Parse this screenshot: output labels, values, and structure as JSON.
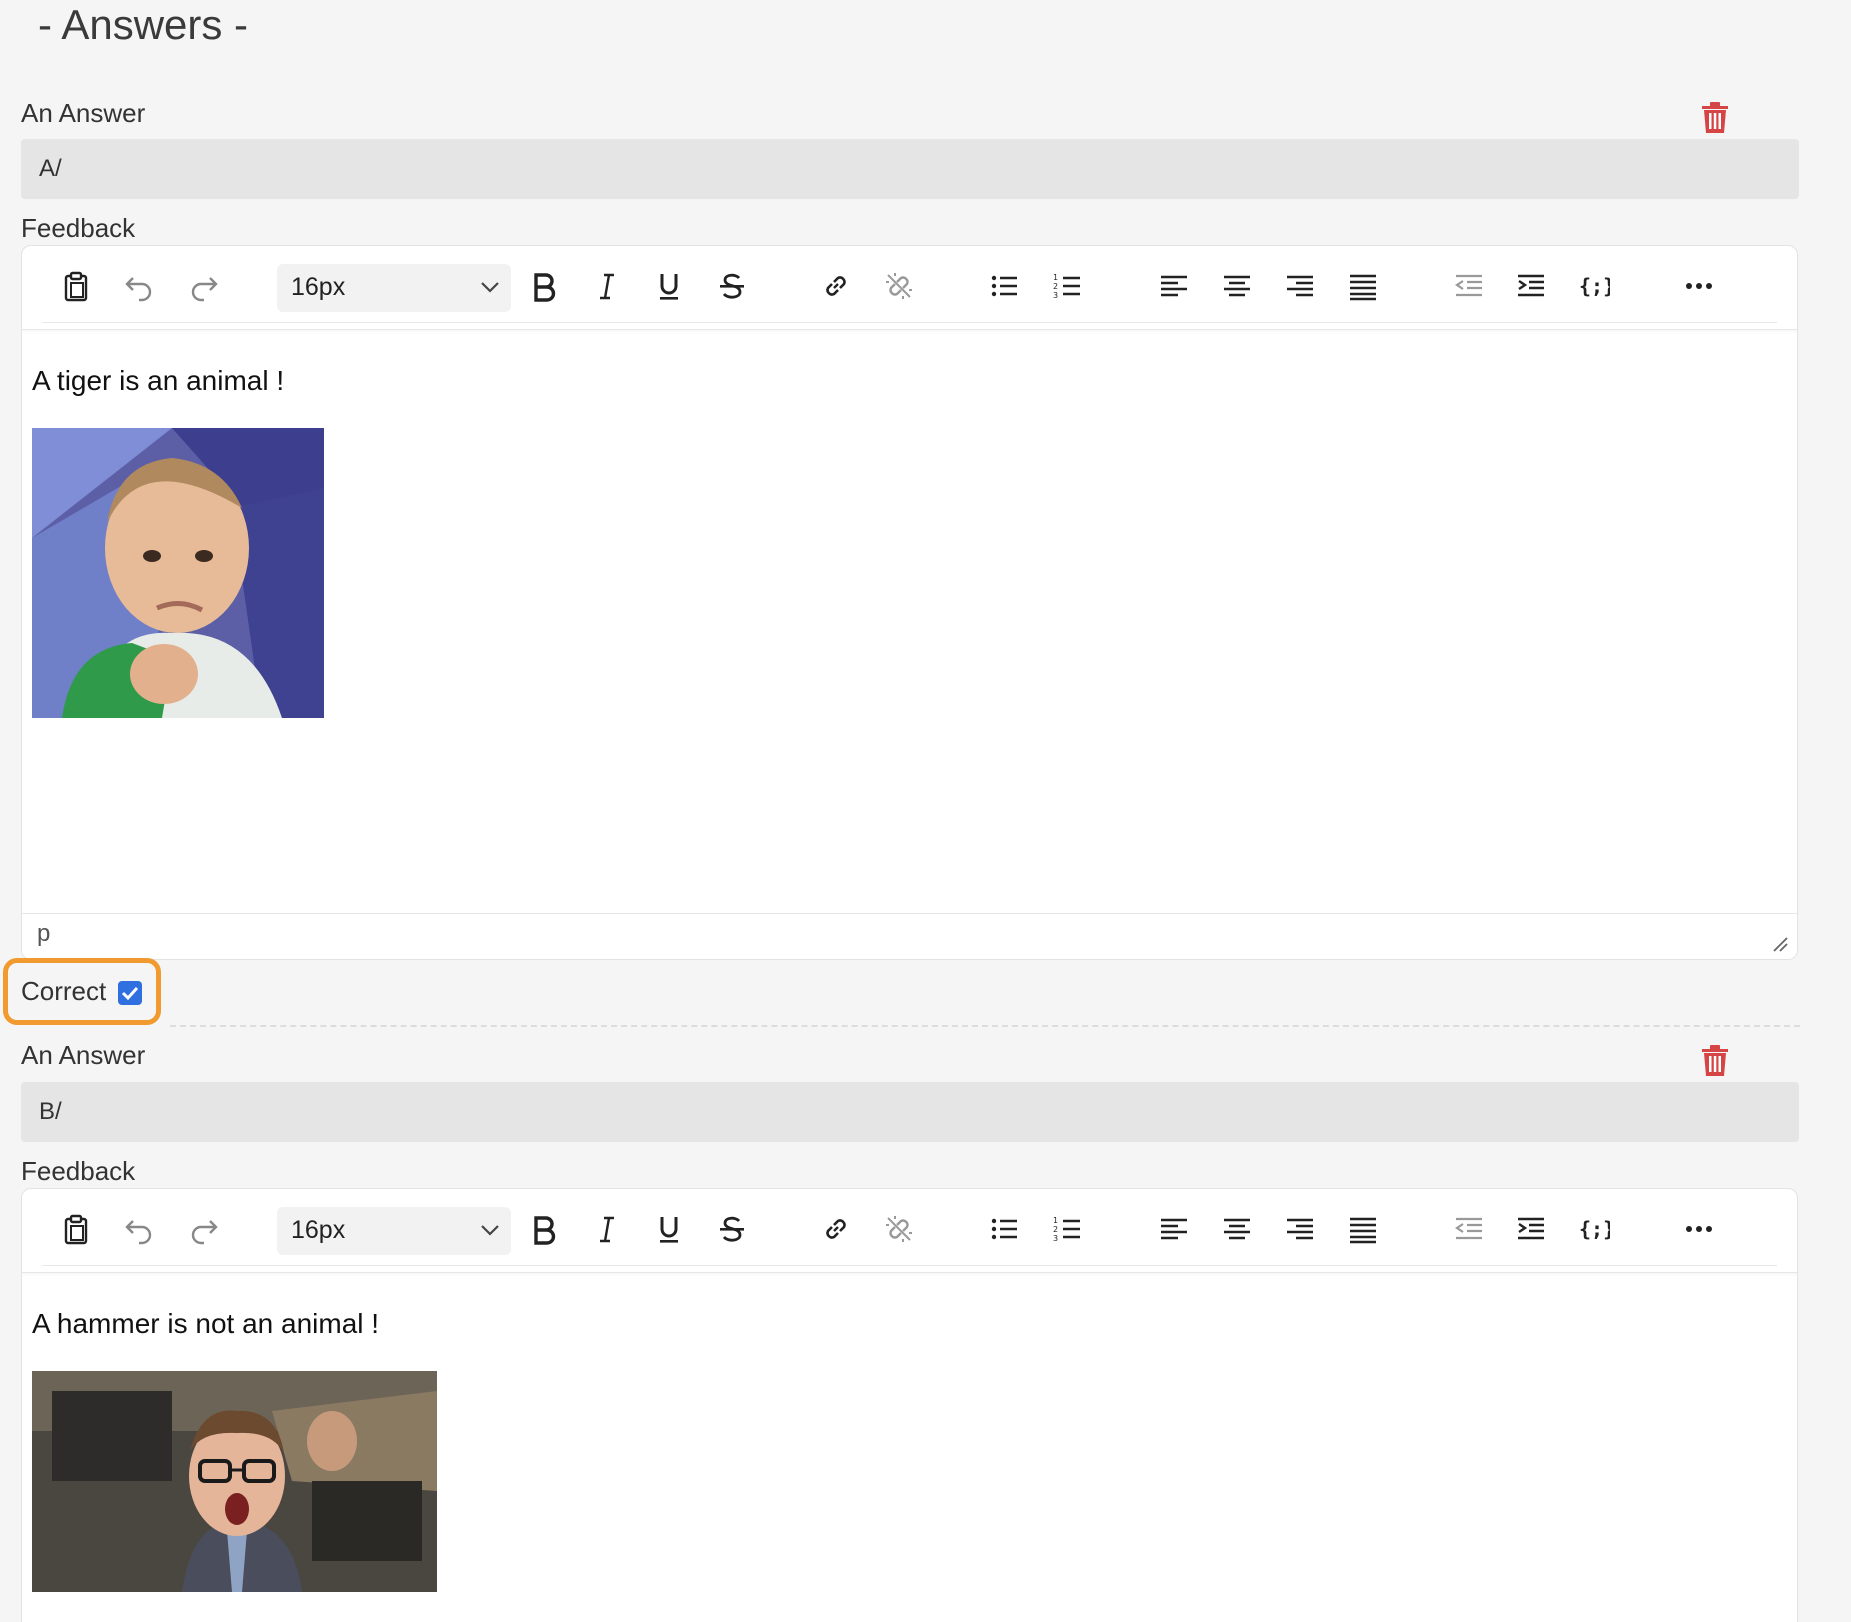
{
  "section_title": "- Answers -",
  "answers": [
    {
      "label": "An Answer",
      "value": "A/",
      "feedback_label": "Feedback",
      "toolbar": {
        "font_size": "16px"
      },
      "content_text": "A tiger is an animal !",
      "status_path": "p",
      "correct_label": "Correct",
      "correct_checked": true
    },
    {
      "label": "An Answer",
      "value": "B/",
      "feedback_label": "Feedback",
      "toolbar": {
        "font_size": "16px"
      },
      "content_text": "A hammer is not an animal !"
    }
  ],
  "colors": {
    "trash": "#d64545",
    "highlight": "#f09a2f",
    "checkbox": "#2f6fe0",
    "input_bg": "#e5e5e5",
    "page_bg": "#f5f5f5"
  },
  "toolbar_icons": [
    "paste-icon",
    "undo-icon",
    "redo-icon",
    "bold-icon",
    "italic-icon",
    "underline-icon",
    "strikethrough-icon",
    "link-icon",
    "unlink-icon",
    "bullet-list-icon",
    "numbered-list-icon",
    "align-left-icon",
    "align-center-icon",
    "align-right-icon",
    "align-justify-icon",
    "outdent-icon",
    "indent-icon",
    "code-icon",
    "more-icon"
  ]
}
